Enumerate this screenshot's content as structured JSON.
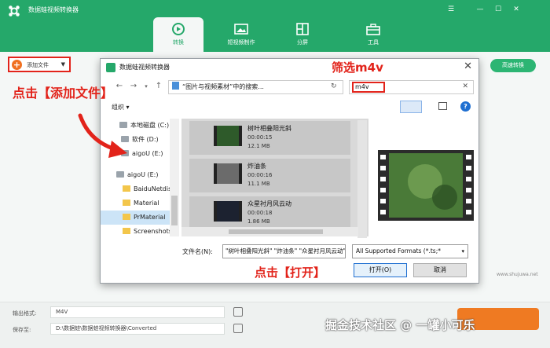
{
  "app": {
    "title": "数据蛙视频转换器",
    "tabs": [
      {
        "label": "转换",
        "icon": "convert-icon",
        "active": true
      },
      {
        "label": "短视频制作",
        "icon": "image-icon",
        "active": false
      },
      {
        "label": "分屏",
        "icon": "split-screen-icon",
        "active": false
      },
      {
        "label": "工具",
        "icon": "toolbox-icon",
        "active": false
      }
    ],
    "add_file_label": "添加文件",
    "convert_all_top": "高速转换",
    "output_format_label": "输出格式:",
    "output_format_value": "M4V",
    "save_to_label": "保存至:",
    "save_to_value": "D:\\数据蛙\\数据蛙视频转换器\\Converted",
    "accent_color": "#25a86a"
  },
  "annotations": {
    "add_file": "点击【添加文件】",
    "filter": "筛选m4v",
    "open": "点击【打开】",
    "annotation_color": "#e2231a"
  },
  "watermark": "掘金技术社区 @ 一罐小可乐",
  "site_mark": "www.shujuwa.net",
  "dialog": {
    "title": "数据蛙视频转换器",
    "address": "“图片与视频素材”中的搜索...",
    "search_value": "m4v",
    "organize_label": "组织",
    "tree": [
      {
        "label": "本地磁盘 (C:)",
        "type": "drive"
      },
      {
        "label": "软件 (D:)",
        "type": "drive"
      },
      {
        "label": "aigoU (E:)",
        "type": "drive"
      },
      {
        "label": "aigoU (E:)",
        "type": "drive"
      },
      {
        "label": "BaiduNetdisk",
        "type": "folder"
      },
      {
        "label": "Material",
        "type": "folder"
      },
      {
        "label": "PrMaterial",
        "type": "folder",
        "selected": true
      },
      {
        "label": "Screenshots",
        "type": "folder"
      }
    ],
    "files": [
      {
        "name": "树叶相叠阳光斜",
        "duration": "00:00:15",
        "size": "12.1 MB"
      },
      {
        "name": "炸油条",
        "duration": "00:00:16",
        "size": "11.1 MB"
      },
      {
        "name": "众星衬月风云动",
        "duration": "00:00:18",
        "size": "1.86 MB"
      }
    ],
    "filename_label": "文件名(N):",
    "filename_value": "\"树叶相叠阳光斜\" \"炸油条\" \"众星衬月风云动\"",
    "format_value": "All Supported Formats (*.ts;*",
    "open_label": "打开(O)",
    "cancel_label": "取消"
  }
}
